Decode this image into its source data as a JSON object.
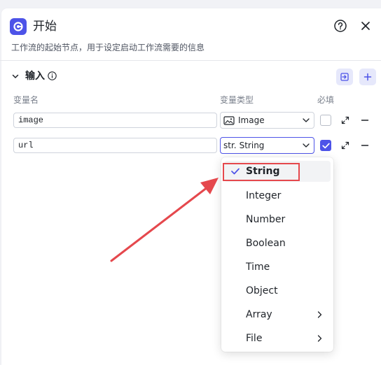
{
  "header": {
    "title": "开始",
    "description": "工作流的起始节点，用于设定启动工作流需要的信息"
  },
  "section": {
    "title": "输入"
  },
  "columns": {
    "name": "变量名",
    "type": "变量类型",
    "required": "必填"
  },
  "rows": [
    {
      "name": "image",
      "type_prefix": "",
      "type_label": "Image",
      "required": false
    },
    {
      "name": "url",
      "type_prefix": "str.",
      "type_label": "String",
      "required": true
    }
  ],
  "dropdown": {
    "items": [
      {
        "label": "String",
        "selected": true,
        "submenu": false
      },
      {
        "label": "Integer",
        "selected": false,
        "submenu": false
      },
      {
        "label": "Number",
        "selected": false,
        "submenu": false
      },
      {
        "label": "Boolean",
        "selected": false,
        "submenu": false
      },
      {
        "label": "Time",
        "selected": false,
        "submenu": false
      },
      {
        "label": "Object",
        "selected": false,
        "submenu": false
      },
      {
        "label": "Array",
        "selected": false,
        "submenu": true
      },
      {
        "label": "File",
        "selected": false,
        "submenu": true
      }
    ]
  },
  "colors": {
    "accent": "#4d53e8",
    "annotation": "#e5484d"
  },
  "icons": {
    "logo": "start-node-icon",
    "help": "help-circle-icon",
    "close": "close-icon",
    "info": "info-icon",
    "collapse": "chevron-down-icon",
    "import": "import-icon",
    "add": "plus-icon",
    "expand": "expand-icon",
    "remove": "minus-icon",
    "image_type": "image-icon",
    "check": "check-icon",
    "submenu": "chevron-right-icon"
  }
}
